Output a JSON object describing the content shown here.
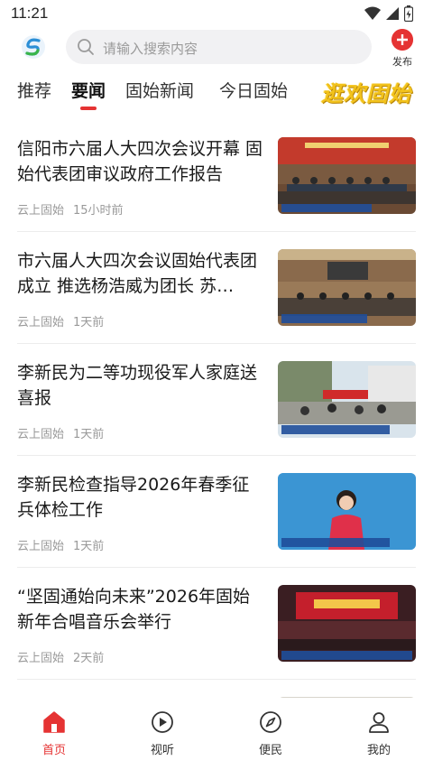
{
  "status_bar": {
    "time": "11:21"
  },
  "header": {
    "search_placeholder": "请输入搜索内容",
    "publish_label": "发布"
  },
  "tabs": [
    {
      "label": "推荐",
      "active": false
    },
    {
      "label": "要闻",
      "active": true
    },
    {
      "label": "固始新闻",
      "active": false
    },
    {
      "label": "今日固始",
      "active": false
    }
  ],
  "banner_tab_text": "逛欢固始",
  "news": [
    {
      "title": "信阳市六届人大四次会议开幕 固始代表团审议政府工作报告",
      "source": "云上固始",
      "time": "15小时前",
      "thumb_caption": "信阳市六届人大四次会议开幕"
    },
    {
      "title": "市六届人大四次会议固始代表团成立 推选杨浩威为团长 苏…",
      "source": "云上固始",
      "time": "1天前",
      "thumb_caption": "市六届人大四次会议固始代表团成立"
    },
    {
      "title": "李新民为二等功现役军人家庭送喜报",
      "source": "云上固始",
      "time": "1天前",
      "thumb_caption": "李新民为二等功现役军人家庭送喜报"
    },
    {
      "title": "李新民检查指导2026年春季征兵体检工作",
      "source": "云上固始",
      "time": "1天前",
      "thumb_caption": "李新民检查指导2026年春季征兵体检工作"
    },
    {
      "title": "“坚固通始向未来”2026年固始新年合唱音乐会举行",
      "source": "云上固始",
      "time": "2天前",
      "thumb_caption": "“坚固通始向未来” 2026年固始新年合唱音乐会举行"
    }
  ],
  "bottom_nav": [
    {
      "label": "首页",
      "icon": "home-icon",
      "active": true
    },
    {
      "label": "视听",
      "icon": "play-icon",
      "active": false
    },
    {
      "label": "便民",
      "icon": "compass-icon",
      "active": false
    },
    {
      "label": "我的",
      "icon": "user-icon",
      "active": false
    }
  ],
  "colors": {
    "accent": "#e53333",
    "meta_text": "#999999",
    "search_bg": "#f1f1f3"
  }
}
